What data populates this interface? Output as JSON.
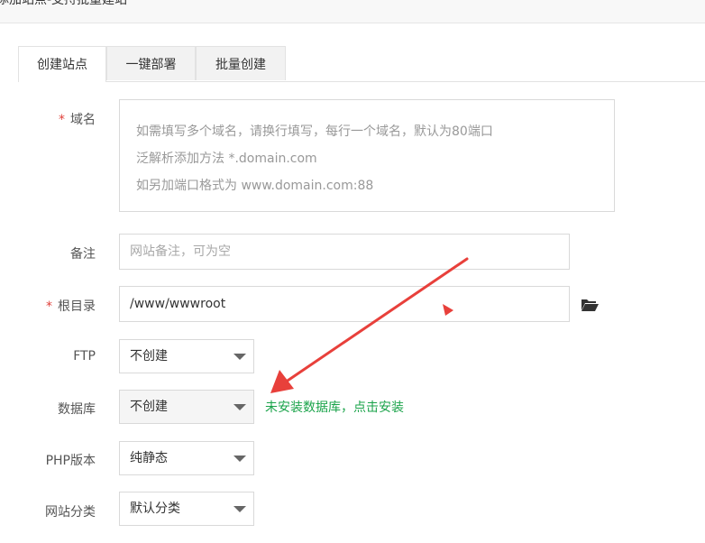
{
  "window": {
    "title": "添加站点-支持批量建站"
  },
  "tabs": [
    {
      "label": "创建站点",
      "active": true
    },
    {
      "label": "一键部署",
      "active": false
    },
    {
      "label": "批量创建",
      "active": false
    }
  ],
  "form": {
    "domain": {
      "required_mark": "*",
      "label": "域名",
      "placeholder_lines": [
        "如需填写多个域名，请换行填写，每行一个域名，默认为80端口",
        "泛解析添加方法 *.domain.com",
        "如另加端口格式为 www.domain.com:88"
      ]
    },
    "remark": {
      "label": "备注",
      "placeholder": "网站备注，可为空"
    },
    "root": {
      "required_mark": "*",
      "label": "根目录",
      "value": "/www/wwwroot",
      "icon": "folder-open-icon"
    },
    "ftp": {
      "label": "FTP",
      "selected": "不创建"
    },
    "database": {
      "label": "数据库",
      "selected": "不创建",
      "hint": "未安装数据库，点击安装"
    },
    "php": {
      "label": "PHP版本",
      "selected": "纯静态"
    },
    "category": {
      "label": "网站分类",
      "selected": "默认分类"
    }
  },
  "colors": {
    "required": "#e0413b",
    "hint": "#1aa34a",
    "annotation_arrow": "#e8403b"
  }
}
